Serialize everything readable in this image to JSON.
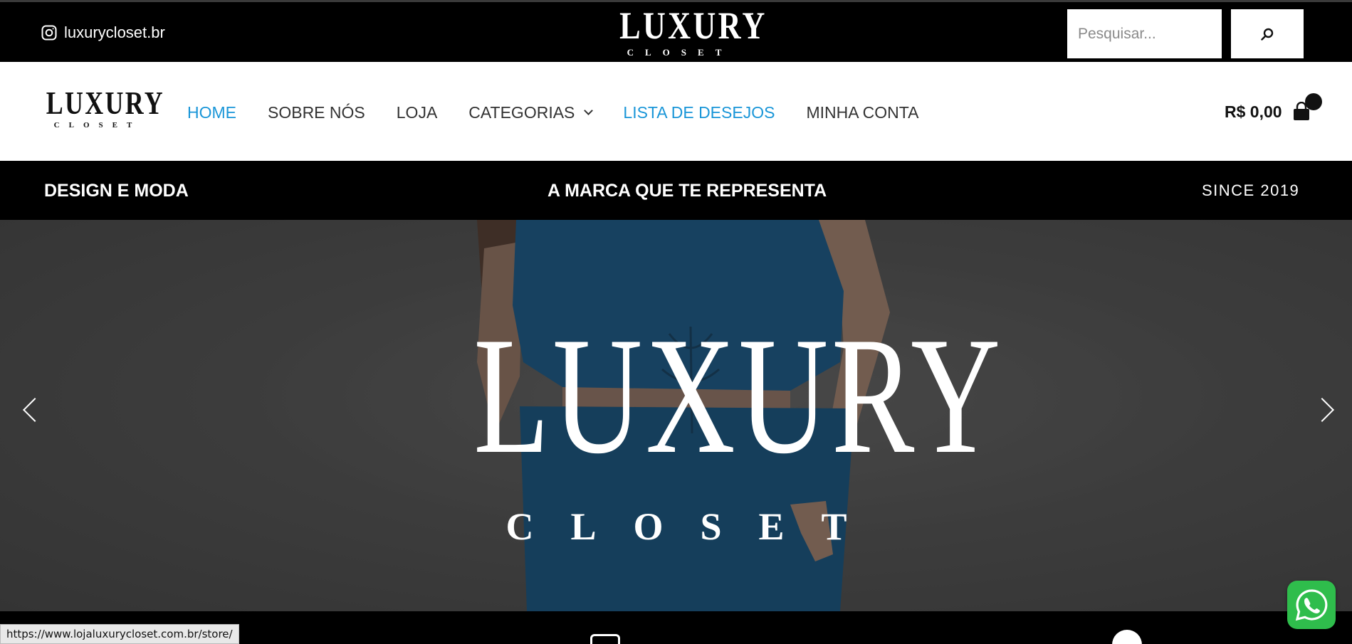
{
  "topbar": {
    "instagram_handle": "luxurycloset.br",
    "logo_word": "LUXURY",
    "logo_sub": "CLOSET",
    "search_placeholder": "Pesquisar..."
  },
  "nav": {
    "logo_word": "LUXURY",
    "logo_sub": "CLOSET",
    "items": [
      {
        "label": "HOME",
        "active": true
      },
      {
        "label": "SOBRE NÓS",
        "active": false
      },
      {
        "label": "LOJA",
        "active": false
      },
      {
        "label": "CATEGORIAS",
        "active": false,
        "dropdown": true
      },
      {
        "label": "LISTA DE DESEJOS",
        "active": true
      },
      {
        "label": "MINHA CONTA",
        "active": false
      }
    ],
    "cart_total": "R$ 0,00",
    "accent_color": "#1a96d8"
  },
  "promo": {
    "left": "DESIGN E MODA",
    "center": "A MARCA QUE TE REPRESENTA",
    "right": "SINCE 2019"
  },
  "hero": {
    "logo_word": "LUXURY",
    "logo_sub": "CLOSET",
    "dress_color": "#0e4f7e"
  },
  "status_bar": {
    "url": "https://www.lojaluxurycloset.com.br/store/"
  },
  "icons": {
    "instagram": "instagram-icon",
    "search": "search-icon",
    "cart": "shopping-bag-icon",
    "whatsapp": "whatsapp-icon",
    "prev": "chevron-left-icon",
    "next": "chevron-right-icon"
  },
  "colors": {
    "whatsapp": "#2fbd4c"
  }
}
